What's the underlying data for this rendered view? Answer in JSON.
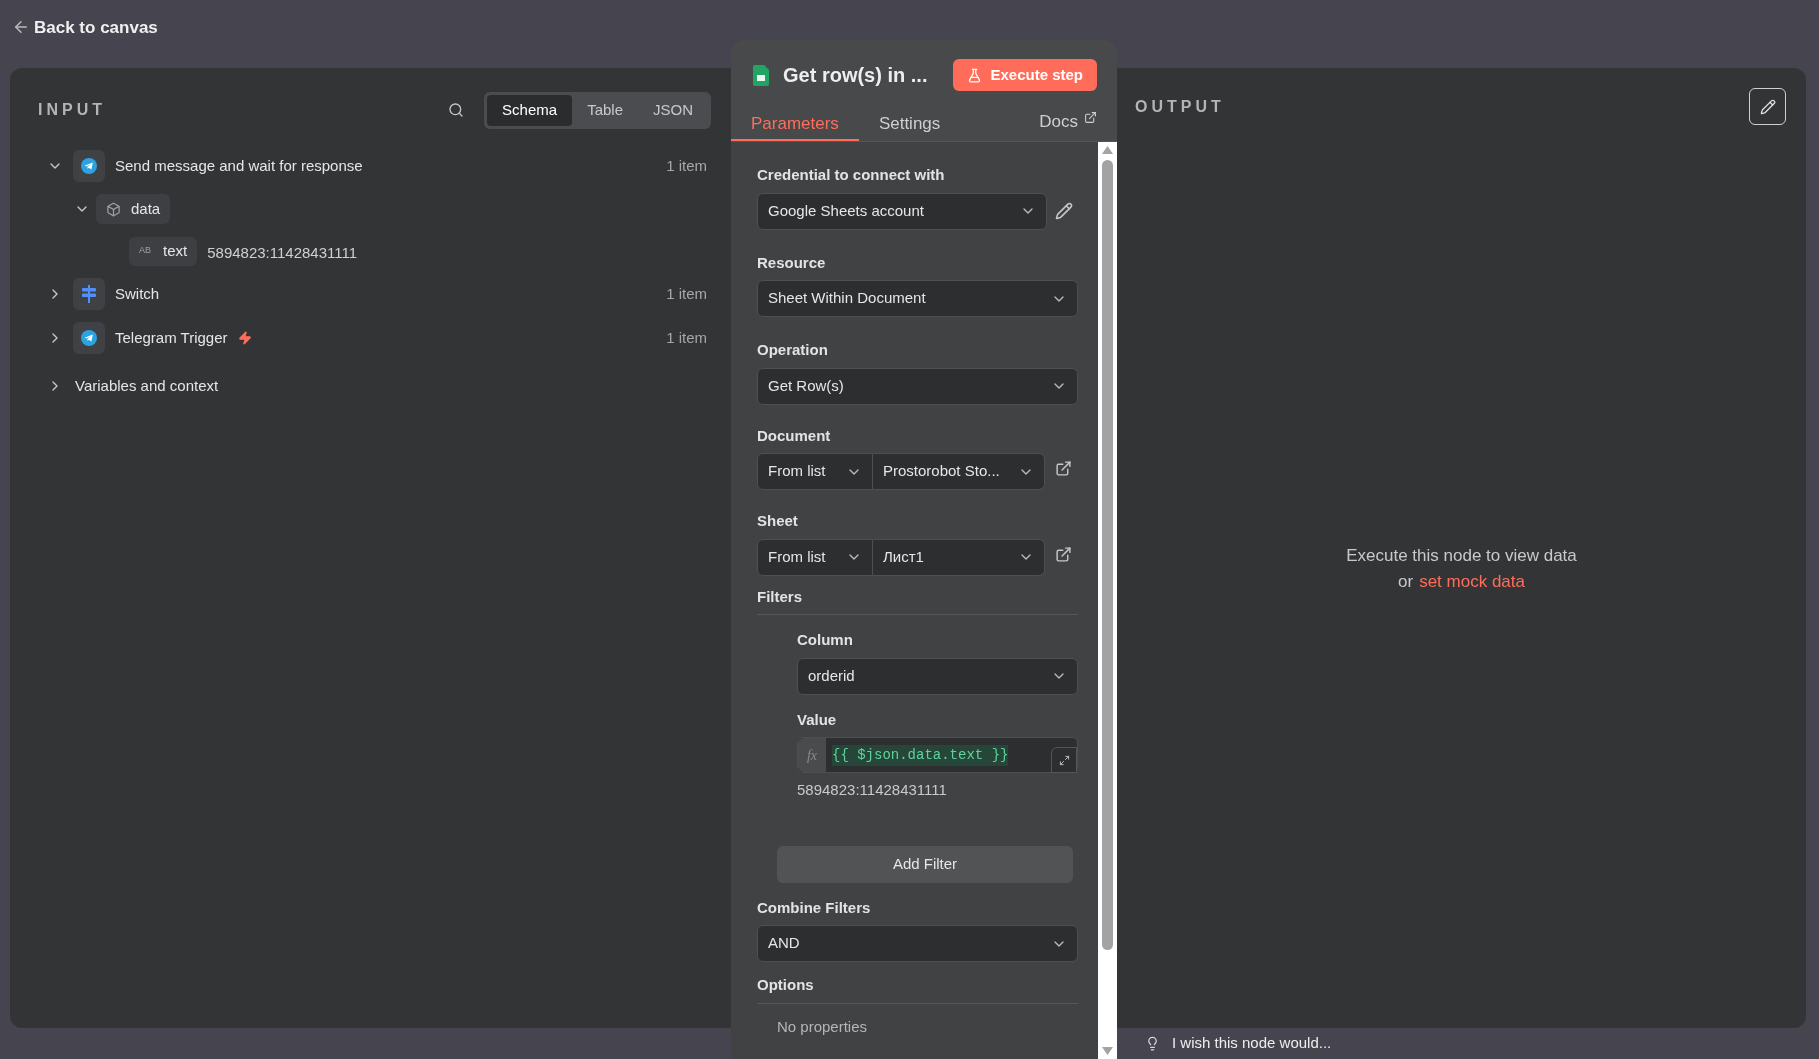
{
  "header": {
    "back_label": "Back to canvas"
  },
  "input_panel": {
    "title": "INPUT",
    "view_tabs": [
      {
        "label": "Schema",
        "selected": true
      },
      {
        "label": "Table",
        "selected": false
      },
      {
        "label": "JSON",
        "selected": false
      }
    ],
    "tree": [
      {
        "kind": "telegram",
        "label": "Send message and wait for response",
        "count": "1 item",
        "expanded": true,
        "trigger": false,
        "children": [
          {
            "label": "data",
            "expanded": true,
            "children": [
              {
                "type_badge": "AB",
                "label": "text",
                "value": "5894823:11428431111"
              }
            ]
          }
        ]
      },
      {
        "kind": "switch",
        "label": "Switch",
        "count": "1 item",
        "expanded": false,
        "trigger": false
      },
      {
        "kind": "telegram",
        "label": "Telegram Trigger",
        "count": "1 item",
        "expanded": false,
        "trigger": true
      }
    ],
    "variables": {
      "label": "Variables and context",
      "expanded": false
    }
  },
  "node_panel": {
    "title": "Get row(s) in ...",
    "execute_button": "Execute step",
    "tabs": [
      {
        "label": "Parameters",
        "selected": true
      },
      {
        "label": "Settings",
        "selected": false
      }
    ],
    "docs_link": "Docs",
    "parameters": [
      {
        "kind": "credential",
        "label": "Credential to connect with",
        "value": "Google Sheets account"
      },
      {
        "kind": "select",
        "label": "Resource",
        "value": "Sheet Within Document"
      },
      {
        "kind": "select",
        "label": "Operation",
        "value": "Get Row(s)"
      },
      {
        "kind": "locator",
        "label": "Document",
        "mode": "From list",
        "value": "Prostorobot Sto..."
      },
      {
        "kind": "locator",
        "label": "Sheet",
        "mode": "From list",
        "value": "Лист1"
      },
      {
        "kind": "filters",
        "label": "Filters",
        "column_label": "Column",
        "column_value": "orderid",
        "value_label": "Value",
        "fx_label": "fx",
        "expression": "{{ $json.data.text }}",
        "preview": "5894823:11428431111",
        "add_button": "Add Filter"
      },
      {
        "kind": "select",
        "label": "Combine Filters",
        "value": "AND"
      },
      {
        "kind": "options",
        "label": "Options",
        "empty_text": "No properties"
      }
    ]
  },
  "output_panel": {
    "title": "OUTPUT",
    "message": "Execute this node to view data",
    "message_prefix": "or",
    "mock_link": "set mock data"
  },
  "feedback": {
    "label": "I wish this node would..."
  }
}
